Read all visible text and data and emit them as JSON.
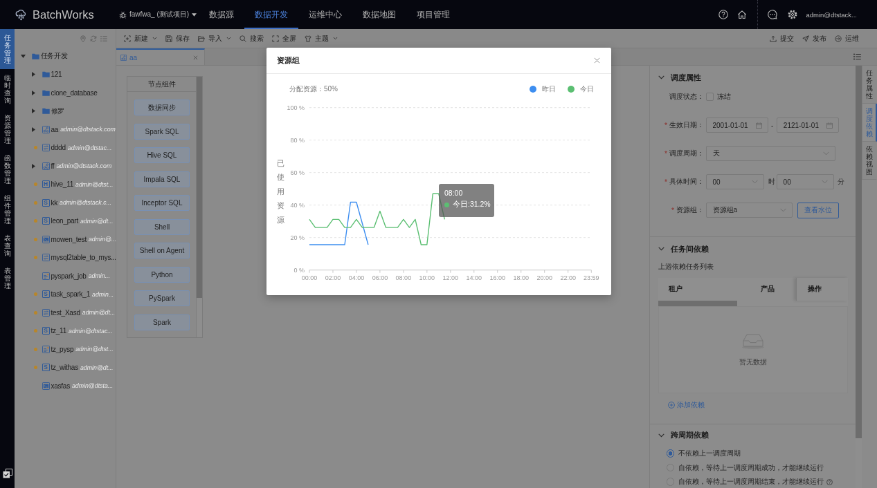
{
  "nav": {
    "logo": "BatchWorks",
    "project": "fawfwa_ (测试项目)",
    "items": [
      {
        "label": "数据源",
        "selected": false
      },
      {
        "label": "数据开发",
        "selected": true
      },
      {
        "label": "运维中心",
        "selected": false
      },
      {
        "label": "数据地图",
        "selected": false
      },
      {
        "label": "项目管理",
        "selected": false
      }
    ],
    "user": "admin@dtstack..."
  },
  "sidebar": {
    "items": [
      {
        "label": "任务管理",
        "selected": true
      },
      {
        "label": "临时查询",
        "selected": false
      },
      {
        "label": "资源管理",
        "selected": false
      },
      {
        "label": "函数管理",
        "selected": false
      },
      {
        "label": "组件管理",
        "selected": false
      },
      {
        "label": "表查询",
        "selected": false
      },
      {
        "label": "表管理",
        "selected": false
      }
    ]
  },
  "tree": {
    "root": {
      "label": "任务开发",
      "expanded": true,
      "children": [
        {
          "name": "121",
          "kind": "folder",
          "expanded": false,
          "unsubmitted": false
        },
        {
          "name": "clone_database",
          "kind": "folder",
          "expanded": false,
          "unsubmitted": false
        },
        {
          "name": "修罗",
          "kind": "folder",
          "expanded": false,
          "unsubmitted": false
        },
        {
          "name": "aa",
          "kind": "workflow",
          "expanded": false,
          "unsubmitted": false,
          "owner": "admin@dtstack.com"
        },
        {
          "name": "dddd",
          "kind": "sync",
          "unsubmitted": true,
          "owner": "admin@dtstac..."
        },
        {
          "name": "ff",
          "kind": "workflow",
          "expanded": false,
          "unsubmitted": false,
          "owner": "admin@dtstack.com"
        },
        {
          "name": "hive_11",
          "kind": "tagged",
          "tag": "H",
          "unsubmitted": true,
          "owner": "admin@dtst..."
        },
        {
          "name": "kk",
          "kind": "tagged",
          "tag": "S",
          "unsubmitted": true,
          "owner": "admin@dtstack.c..."
        },
        {
          "name": "leon_part",
          "kind": "tagged",
          "tag": "S",
          "unsubmitted": true,
          "owner": "admin@dt..."
        },
        {
          "name": "mowen_test",
          "kind": "shell",
          "unsubmitted": true,
          "owner": "admin@..."
        },
        {
          "name": "mysql2table_to_mys...",
          "kind": "sync",
          "unsubmitted": true
        },
        {
          "name": "pyspark_job",
          "kind": "pyspark",
          "unsubmitted": false,
          "owner": "admin..."
        },
        {
          "name": "task_spark_1",
          "kind": "tagged",
          "tag": "S",
          "unsubmitted": true,
          "owner": "admin..."
        },
        {
          "name": "test_Xasd",
          "kind": "sync",
          "unsubmitted": true,
          "owner": "admin@dt..."
        },
        {
          "name": "tz_11",
          "kind": "tagged",
          "tag": "S",
          "unsubmitted": true,
          "owner": "admin@dtstac..."
        },
        {
          "name": "tz_pysp",
          "kind": "pyspark",
          "unsubmitted": true,
          "owner": "admin@dtst..."
        },
        {
          "name": "tz_withas",
          "kind": "tagged",
          "tag": "S",
          "unsubmitted": true,
          "owner": "admin@dt..."
        },
        {
          "name": "xasfas",
          "kind": "shell",
          "unsubmitted": false,
          "owner": "admin@dtsta..."
        }
      ]
    }
  },
  "toolbar": {
    "left": [
      {
        "label": "新建",
        "kind": "new",
        "dropdown": true
      },
      {
        "label": "保存",
        "kind": "save",
        "dropdown": false
      },
      {
        "label": "导入",
        "kind": "import",
        "dropdown": true
      },
      {
        "label": "搜索",
        "kind": "search",
        "dropdown": false
      },
      {
        "label": "全屏",
        "kind": "fullscreen",
        "dropdown": false
      },
      {
        "label": "主题",
        "kind": "theme",
        "dropdown": true
      }
    ],
    "right": [
      {
        "label": "提交",
        "kind": "submit"
      },
      {
        "label": "发布",
        "kind": "publish"
      },
      {
        "label": "运维",
        "kind": "operations"
      }
    ]
  },
  "editor_tabs": [
    {
      "label": "aa",
      "kind": "workflow",
      "selected": true
    }
  ],
  "node_panel": {
    "title": "节点组件",
    "items": [
      "数据同步",
      "Spark SQL",
      "Hive SQL",
      "Impala SQL",
      "Inceptor SQL",
      "Shell",
      "Shell on Agent",
      "Python",
      "PySpark",
      "Spark"
    ]
  },
  "schedule": {
    "title": "调度属性",
    "expanded": true,
    "status": {
      "label": "调度状态：",
      "option": "冻结",
      "checked": false
    },
    "fields": [
      {
        "kind": "date_range",
        "mark": "*",
        "label": "生效日期：",
        "start": "2001-01-01",
        "separator": "-",
        "end": "2121-01-01"
      },
      {
        "kind": "select",
        "mark": "*",
        "label": "调度周期：",
        "value": "天"
      },
      {
        "kind": "time",
        "mark": "*",
        "label": "具体时间：",
        "hour": "00",
        "hour_unit": "时",
        "minute": "00",
        "minute_unit": "分"
      },
      {
        "kind": "select",
        "mark": "*",
        "label": "资源组：",
        "value": "资源组a",
        "button": "查看水位"
      }
    ]
  },
  "task_dependency": {
    "title": "任务间依赖",
    "expanded": true,
    "list_title": "上游依赖任务列表",
    "columns": [
      "租户",
      "产品",
      "操作"
    ],
    "empty_text": "暂无数据",
    "add_link": "添加依赖"
  },
  "cross_cycle_dependency": {
    "title": "跨周期依赖",
    "expanded": true,
    "options": [
      {
        "label": "不依赖上一调度周期",
        "selected": true,
        "help": false
      },
      {
        "label": "自依赖，等待上一调度周期成功，才能继续运行",
        "selected": false,
        "help": false
      },
      {
        "label": "自依赖，等待上一调度周期结束，才能继续运行",
        "selected": false,
        "help": true
      }
    ]
  },
  "side_tabs": [
    {
      "label": "任务属性",
      "selected": false
    },
    {
      "label": "调度依赖",
      "selected": true
    },
    {
      "label": "依赖视图",
      "selected": false
    }
  ],
  "modal": {
    "title": "资源组",
    "allocation": "分配资源：50%",
    "chart_data": {
      "type": "line",
      "ylabel": "已使用资源",
      "x": [
        0,
        0.5,
        1,
        1.5,
        2,
        2.5,
        3,
        3.5,
        4,
        4.5,
        5,
        5.5,
        6,
        6.5,
        7,
        7.5,
        8,
        8.5,
        9,
        9.5,
        10,
        10.5,
        11,
        11.5
      ],
      "series": [
        {
          "name": "昨日",
          "color": "#3d8ef0",
          "values": [
            15.6,
            15.6,
            15.6,
            15.6,
            15.6,
            15.6,
            15.6,
            41.8,
            41.8,
            28.7,
            15.6,
            null,
            null,
            null,
            null,
            null,
            null,
            null,
            null,
            null,
            null,
            null,
            null,
            null
          ]
        },
        {
          "name": "今日",
          "color": "#5bbf72",
          "values": [
            31.2,
            26.2,
            26.2,
            26.2,
            31.2,
            31.2,
            26.2,
            26.2,
            31.2,
            26.2,
            26.2,
            26.2,
            36.3,
            26.2,
            26.2,
            26.2,
            31.2,
            26.2,
            31.2,
            15.6,
            15.6,
            47,
            47,
            31.2
          ]
        }
      ],
      "xlim": [
        0,
        23.98
      ],
      "ylim": [
        0,
        100
      ],
      "xticks": [
        {
          "value": 0,
          "label": "00:00"
        },
        {
          "value": 2,
          "label": "02:00"
        },
        {
          "value": 4,
          "label": "04:00"
        },
        {
          "value": 6,
          "label": "06:00"
        },
        {
          "value": 8,
          "label": "08:00"
        },
        {
          "value": 10,
          "label": "10:00"
        },
        {
          "value": 12,
          "label": "12:00"
        },
        {
          "value": 14,
          "label": "14:00"
        },
        {
          "value": 16,
          "label": "16:00"
        },
        {
          "value": 18,
          "label": "18:00"
        },
        {
          "value": 20,
          "label": "20:00"
        },
        {
          "value": 22,
          "label": "22:00"
        },
        {
          "value": 23.98,
          "label": "23:59"
        }
      ],
      "yticks": [
        {
          "value": 0,
          "label": "0 %"
        },
        {
          "value": 20,
          "label": "20 %"
        },
        {
          "value": 40,
          "label": "40 %"
        },
        {
          "value": 60,
          "label": "60 %"
        },
        {
          "value": 80,
          "label": "80 %"
        },
        {
          "value": 100,
          "label": "100 %"
        }
      ],
      "grid": true
    },
    "tooltip": {
      "title": "08:00",
      "text": "今日:31.2%"
    }
  }
}
